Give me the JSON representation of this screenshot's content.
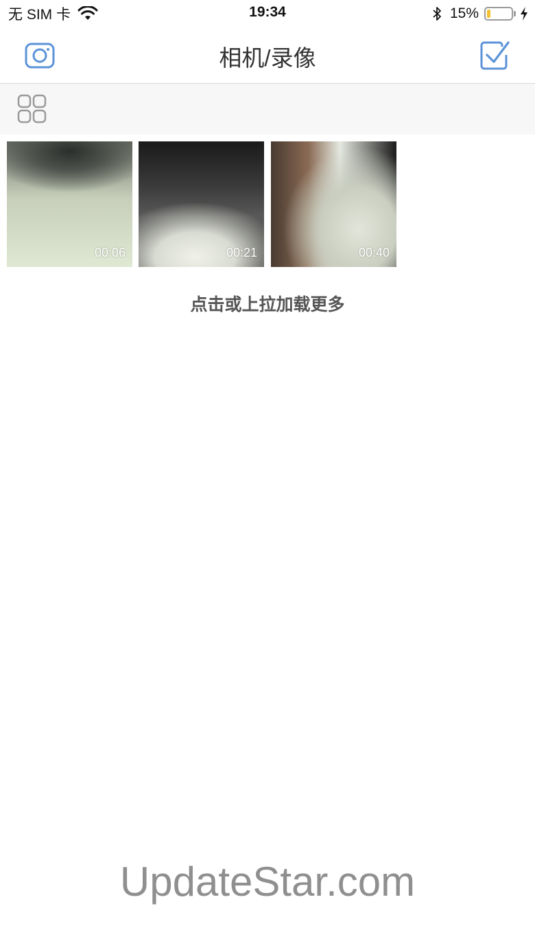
{
  "status_bar": {
    "carrier": "无 SIM 卡",
    "time": "19:34",
    "battery_percent_text": "15%",
    "battery_level": 0.15,
    "battery_color": "#f2c230"
  },
  "nav": {
    "title": "相机/录像",
    "left_icon": "camera-icon",
    "right_icon": "check-square-icon",
    "accent_color": "#5b93d9"
  },
  "toolbar": {
    "icon": "grid-icon"
  },
  "videos": [
    {
      "duration": "00:06"
    },
    {
      "duration": "00:21"
    },
    {
      "duration": "00:40"
    }
  ],
  "load_more": "点击或上拉加载更多",
  "watermark": "UpdateStar.com"
}
